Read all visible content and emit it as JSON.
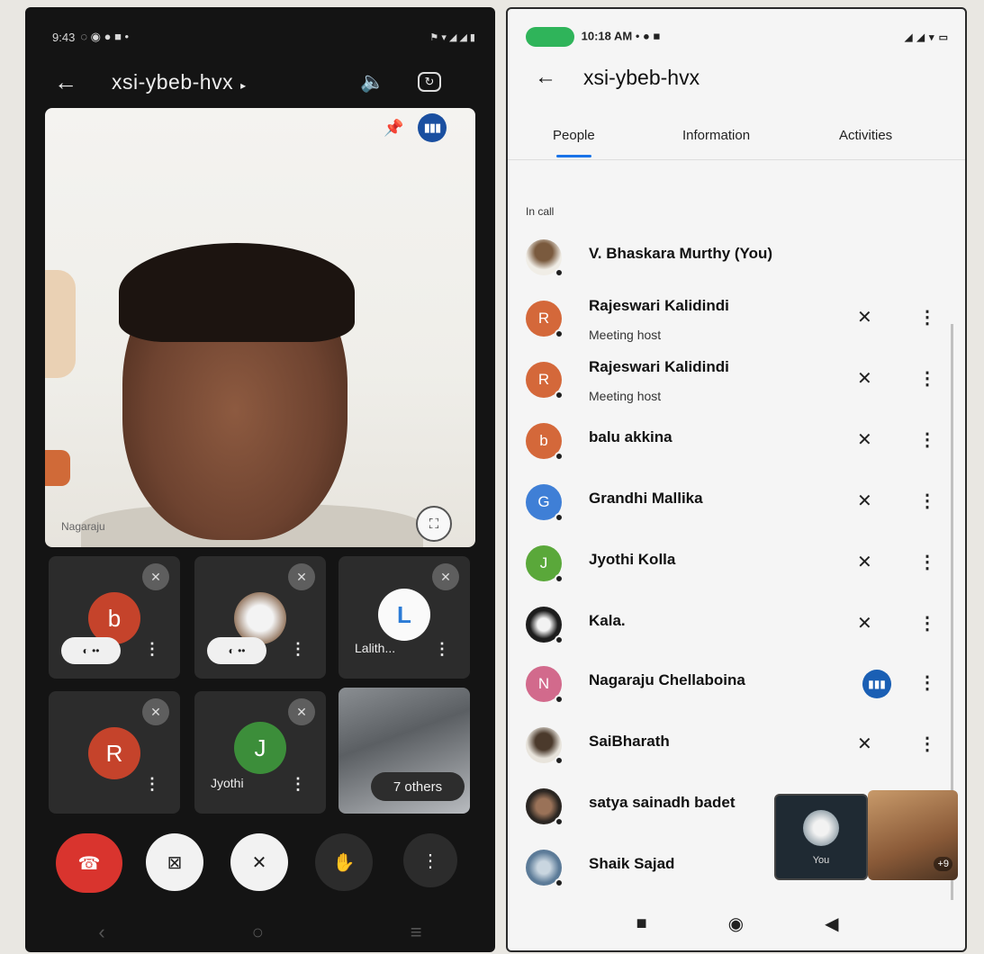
{
  "left": {
    "status": {
      "time": "9:43",
      "icons": "◌ ◉ ● ■ •",
      "signal": "⚑ ▾ ◢ ◢ ▮"
    },
    "meeting_code": "xsi-ybeb-hvx",
    "caret": "▸",
    "main_video_name": "Nagaraju",
    "tiles": [
      {
        "avatar": "b",
        "color": "#c5432b",
        "pill": "◐ ••"
      },
      {
        "avatar": "",
        "pill": "◐ ••"
      },
      {
        "avatar": "L",
        "name": "Lalith..."
      },
      {
        "avatar": "R",
        "color": "#c5432b"
      },
      {
        "avatar": "J",
        "color": "#3c8e3a",
        "name": "Jyothi"
      },
      {
        "others": "7 others"
      }
    ],
    "controls": {
      "end_call": "☎",
      "camera_off": "⊠",
      "mic_off": "✕",
      "raise_hand": "✋",
      "more": "⋮"
    }
  },
  "right": {
    "status": {
      "time": "10:18 AM",
      "extra": "• ● ■",
      "signal": "◢ ◢ ▾ ▭"
    },
    "meeting_code": "xsi-ybeb-hvx",
    "tabs": [
      "People",
      "Information",
      "Activities"
    ],
    "section": "In call",
    "participants": [
      {
        "name": "V. Bhaskara Murthy (You)",
        "initial": "",
        "color": "#6b4a30"
      },
      {
        "name": "Rajeswari Kalidindi",
        "sub": "Meeting host",
        "initial": "R",
        "color": "#d4683a"
      },
      {
        "name": "Rajeswari Kalidindi",
        "sub": "Meeting host",
        "initial": "R",
        "color": "#d4683a"
      },
      {
        "name": "balu akkina",
        "initial": "b",
        "color": "#d4683a"
      },
      {
        "name": "Grandhi Mallika",
        "initial": "G",
        "color": "#3f7fd6"
      },
      {
        "name": "Jyothi Kolla",
        "initial": "J",
        "color": "#5aa83a"
      },
      {
        "name": "Kala.",
        "initial": "",
        "color": "#1d1d1d"
      },
      {
        "name": "Nagaraju Chellaboina",
        "initial": "N",
        "color": "#d26a8c",
        "speaking": true
      },
      {
        "name": "SaiBharath",
        "initial": "",
        "color": "#8a7a66"
      },
      {
        "name": "satya sainadh badet",
        "initial": "",
        "color": "#2b2622"
      },
      {
        "name": "Shaik Sajad",
        "initial": "",
        "color": "#5c7b98"
      }
    ],
    "pip_label": "You",
    "pip_count": "+9"
  }
}
